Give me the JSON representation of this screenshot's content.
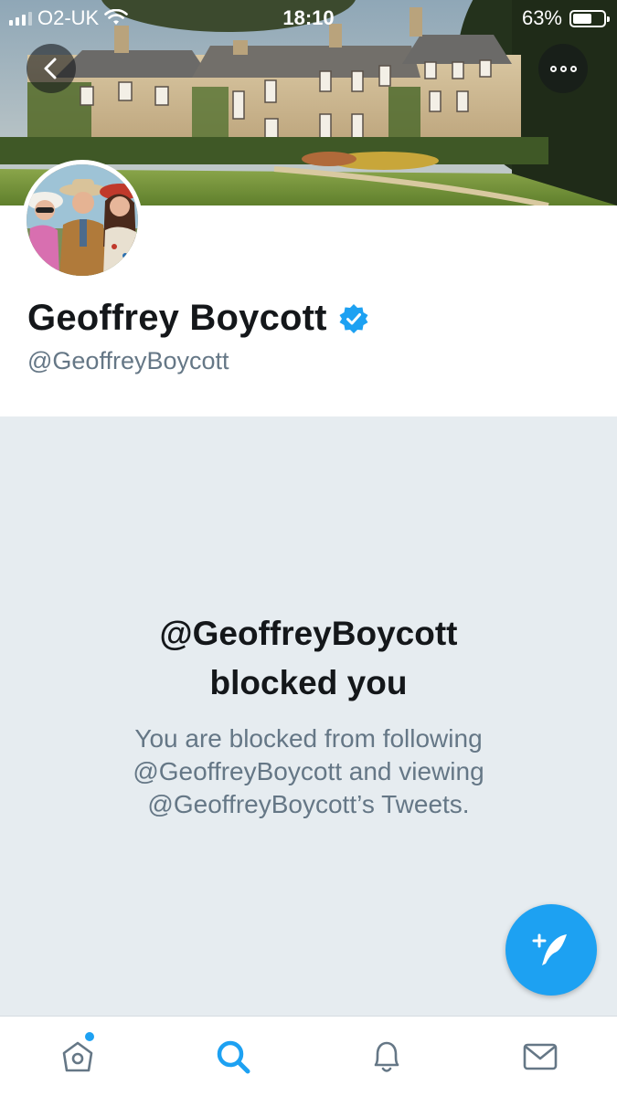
{
  "status_bar": {
    "carrier": "O2-UK",
    "time": "18:10",
    "battery": "63%",
    "battery_level": 0.63
  },
  "header": {
    "back_icon": "chevron-left-icon",
    "more_icon": "more-options-icon"
  },
  "profile": {
    "name": "Geoffrey Boycott",
    "handle": "@GeoffreyBoycott",
    "verified_icon": "verified-badge-icon"
  },
  "blocked": {
    "title_line1": "@GeoffreyBoycott",
    "title_line2": "blocked you",
    "desc_line1": "You are blocked from following",
    "desc_line2": "@GeoffreyBoycott and viewing",
    "desc_line3": "@GeoffreyBoycott’s Tweets."
  },
  "fab": {
    "icon": "compose-tweet-icon"
  },
  "tab_bar": {
    "items": [
      {
        "icon": "home-icon",
        "has_badge": true
      },
      {
        "icon": "search-icon",
        "active": true
      },
      {
        "icon": "notifications-bell-icon"
      },
      {
        "icon": "messages-envelope-icon"
      }
    ]
  },
  "colors": {
    "accent": "#1da1f2",
    "background": "#e6ecf0",
    "text_primary": "#14171a",
    "text_secondary": "#657786"
  }
}
